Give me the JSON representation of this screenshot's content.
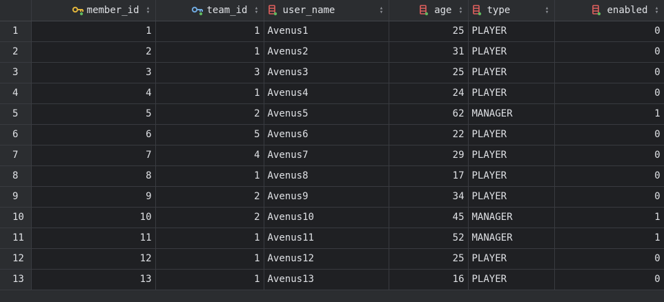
{
  "columns": [
    {
      "key": "member_id",
      "label": "member_id",
      "icon": "primary-key-icon",
      "align": "right"
    },
    {
      "key": "team_id",
      "label": "team_id",
      "icon": "foreign-key-icon",
      "align": "right"
    },
    {
      "key": "user_name",
      "label": "user_name",
      "icon": "column-icon",
      "align": "left"
    },
    {
      "key": "age",
      "label": "age",
      "icon": "column-icon",
      "align": "right"
    },
    {
      "key": "type",
      "label": "type",
      "icon": "column-icon",
      "align": "left"
    },
    {
      "key": "enabled",
      "label": "enabled",
      "icon": "column-icon",
      "align": "right"
    }
  ],
  "rows": [
    {
      "n": "1",
      "member_id": "1",
      "team_id": "1",
      "user_name": "Avenus1",
      "age": "25",
      "type": "PLAYER",
      "enabled": "0"
    },
    {
      "n": "2",
      "member_id": "2",
      "team_id": "1",
      "user_name": "Avenus2",
      "age": "31",
      "type": "PLAYER",
      "enabled": "0"
    },
    {
      "n": "3",
      "member_id": "3",
      "team_id": "3",
      "user_name": "Avenus3",
      "age": "25",
      "type": "PLAYER",
      "enabled": "0"
    },
    {
      "n": "4",
      "member_id": "4",
      "team_id": "1",
      "user_name": "Avenus4",
      "age": "24",
      "type": "PLAYER",
      "enabled": "0"
    },
    {
      "n": "5",
      "member_id": "5",
      "team_id": "2",
      "user_name": "Avenus5",
      "age": "62",
      "type": "MANAGER",
      "enabled": "1"
    },
    {
      "n": "6",
      "member_id": "6",
      "team_id": "5",
      "user_name": "Avenus6",
      "age": "22",
      "type": "PLAYER",
      "enabled": "0"
    },
    {
      "n": "7",
      "member_id": "7",
      "team_id": "4",
      "user_name": "Avenus7",
      "age": "29",
      "type": "PLAYER",
      "enabled": "0"
    },
    {
      "n": "8",
      "member_id": "8",
      "team_id": "1",
      "user_name": "Avenus8",
      "age": "17",
      "type": "PLAYER",
      "enabled": "0"
    },
    {
      "n": "9",
      "member_id": "9",
      "team_id": "2",
      "user_name": "Avenus9",
      "age": "34",
      "type": "PLAYER",
      "enabled": "0"
    },
    {
      "n": "10",
      "member_id": "10",
      "team_id": "2",
      "user_name": "Avenus10",
      "age": "45",
      "type": "MANAGER",
      "enabled": "1"
    },
    {
      "n": "11",
      "member_id": "11",
      "team_id": "1",
      "user_name": "Avenus11",
      "age": "52",
      "type": "MANAGER",
      "enabled": "1"
    },
    {
      "n": "12",
      "member_id": "12",
      "team_id": "1",
      "user_name": "Avenus12",
      "age": "25",
      "type": "PLAYER",
      "enabled": "0"
    },
    {
      "n": "13",
      "member_id": "13",
      "team_id": "1",
      "user_name": "Avenus13",
      "age": "16",
      "type": "PLAYER",
      "enabled": "0"
    }
  ],
  "colors": {
    "background": "#2b2d30",
    "cell_background": "#1f2023",
    "grid_line": "#393b40",
    "text": "#dfe1e5",
    "primary_key_icon": "#e0b43c",
    "foreign_key_icon": "#6fa8dc",
    "column_icon": "#e0605e",
    "not_null_dot": "#5fb85f"
  }
}
